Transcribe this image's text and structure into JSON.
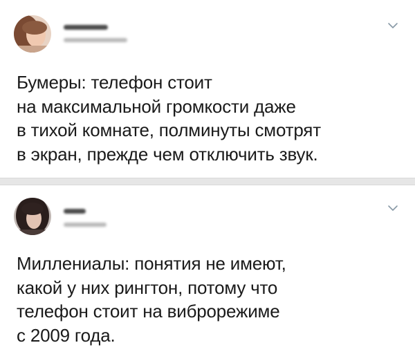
{
  "tweets": [
    {
      "lines": [
        "Бумеры: телефон стоит",
        "на максимальной громкости даже",
        "в тихой комнате, полминуты смотрят",
        "в экран, прежде чем отключить звук."
      ],
      "menu_icon": "chevron-down-icon"
    },
    {
      "lines": [
        "Миллениалы: понятия не имеют,",
        "какой у них рингтон, потому что",
        "телефон стоит на виброрежиме",
        "с 2009 года."
      ],
      "menu_icon": "chevron-down-icon"
    }
  ],
  "colors": {
    "text": "#1a1a1a",
    "separator": "#e6e6e6",
    "chevron": "#8899a6"
  }
}
